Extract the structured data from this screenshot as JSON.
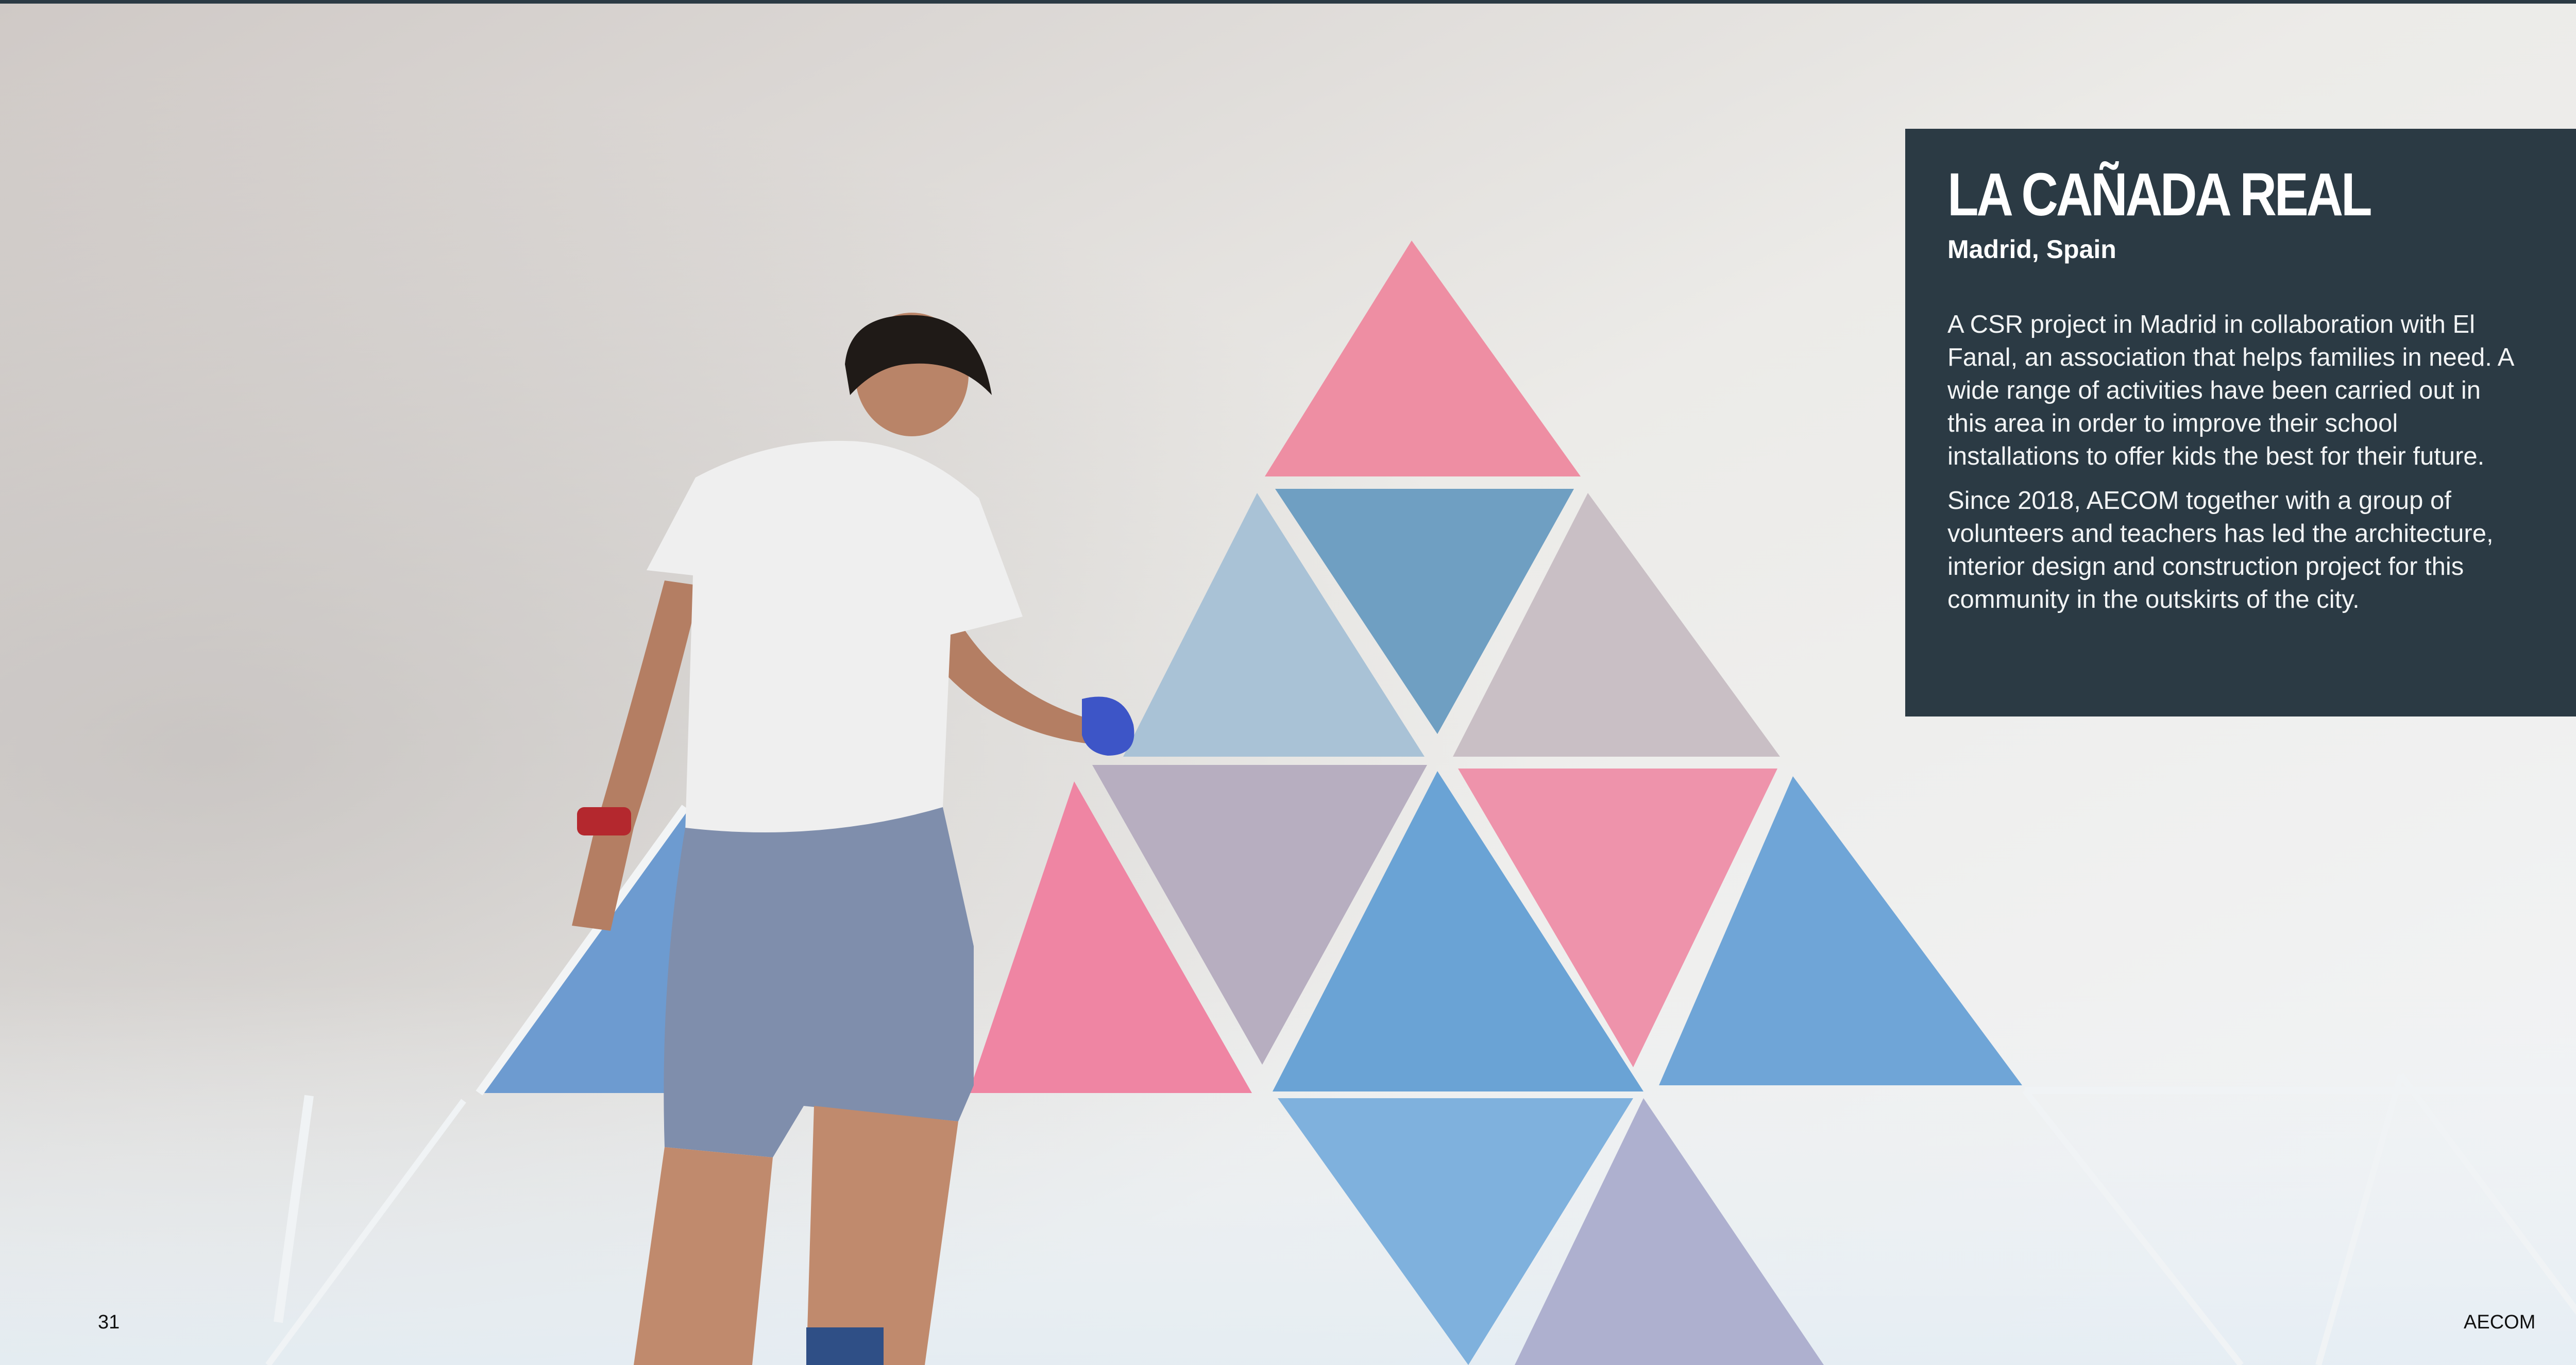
{
  "project": {
    "title": "LA CAÑADA REAL",
    "location": "Madrid, Spain",
    "paragraphs": [
      "A CSR project in Madrid in collaboration with El Fanal, an association that helps families in need. A wide range of activities have been carried out in this area in order to improve their school installations to offer kids the best for their future.",
      "Since 2018, AECOM together with a group of volunteers and teachers has led the architecture, interior design and construction project for this community in the outskirts of the city."
    ]
  },
  "footer": {
    "page_number": "31",
    "brand": "AECOM"
  },
  "colors": {
    "panel": "#2b3a44",
    "triangle_pink": "#ec93a8",
    "triangle_blue": "#78a8d4",
    "triangle_mauve": "#b9aec0",
    "wall": "#eceae7"
  }
}
